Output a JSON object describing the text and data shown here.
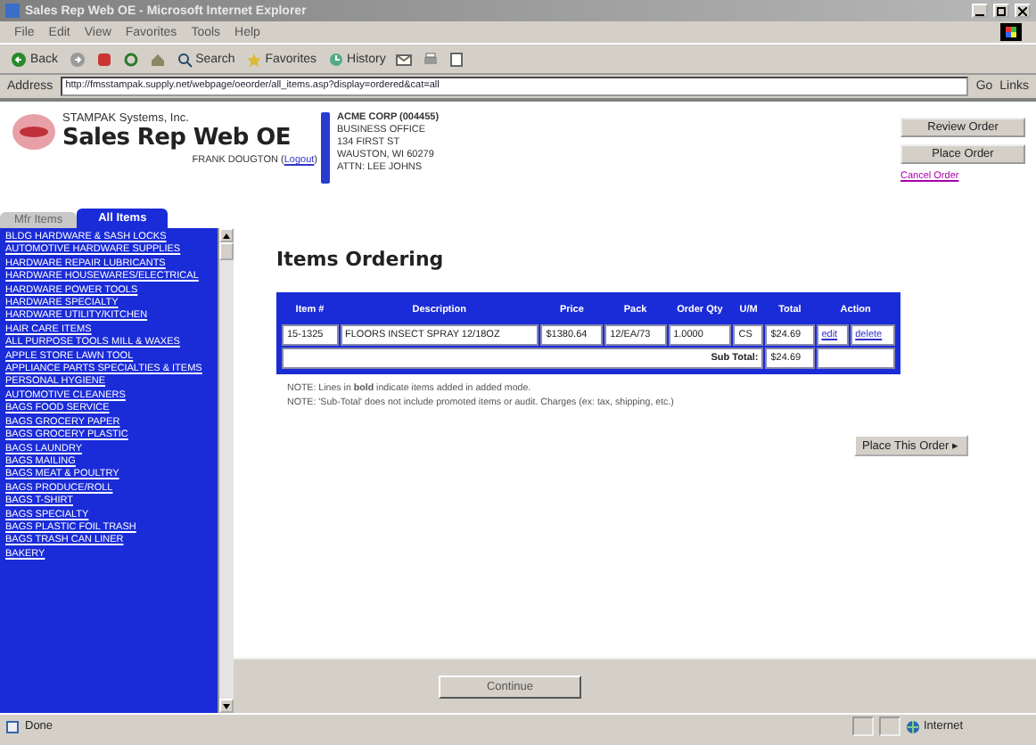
{
  "window": {
    "title": "Sales Rep Web OE - Microsoft Internet Explorer"
  },
  "menu": [
    "File",
    "Edit",
    "View",
    "Favorites",
    "Tools",
    "Help"
  ],
  "toolbar": {
    "back": "Back",
    "buttons": [
      "Search",
      "Favorites",
      "History"
    ]
  },
  "address": {
    "label": "Address",
    "value": "http://fmsstampak.supply.net/webpage/oeorder/all_items.asp?display=ordered&cat=all",
    "go": "Go",
    "links": "Links"
  },
  "header": {
    "company": "STAMPAK Systems, Inc.",
    "app_name": "Sales Rep Web OE",
    "user": "FRANK DOUGTON",
    "logout_open": "(",
    "logout": "Logout",
    "logout_close": ")",
    "customer_lines": [
      "ACME CORP (004455)",
      "BUSINESS OFFICE",
      "134 FIRST ST",
      "WAUSTON, WI 60279",
      "ATTN: LEE JOHNS"
    ],
    "actions": [
      "Review Order",
      "Place Order"
    ],
    "cancel_link": "Cancel Order"
  },
  "tabs": [
    {
      "label": "Mfr Items",
      "selected": false
    },
    {
      "label": "All Items",
      "selected": true
    }
  ],
  "categories": [
    "BLDG HARDWARE & SASH LOCKS",
    "AUTOMOTIVE HARDWARE SUPPLIES",
    "HARDWARE REPAIR LUBRICANTS",
    "HARDWARE HOUSEWARES/ELECTRICAL",
    "HARDWARE POWER TOOLS",
    "HARDWARE SPECIALTY",
    "HARDWARE UTILITY/KITCHEN",
    "HAIR CARE ITEMS",
    "ALL PURPOSE TOOLS MILL & WAXES",
    "APPLE STORE LAWN TOOL",
    "APPLIANCE PARTS SPECIALTIES & ITEMS",
    "PERSONAL HYGIENE",
    "AUTOMOTIVE CLEANERS",
    "BAGS FOOD SERVICE",
    "BAGS GROCERY PAPER",
    "BAGS GROCERY PLASTIC",
    "BAGS LAUNDRY",
    "BAGS MAILING",
    "BAGS MEAT & POULTRY",
    "BAGS PRODUCE/ROLL",
    "BAGS T-SHIRT",
    "BAGS SPECIALTY",
    "BAGS PLASTIC FOIL TRASH",
    "BAGS TRASH CAN LINER",
    "BAKERY"
  ],
  "main": {
    "heading": "Items Ordering",
    "table": {
      "columns": [
        "Item #",
        "Description",
        "Price",
        "Pack",
        "Order Qty",
        "U/M",
        "Total",
        "Action"
      ],
      "rows": [
        {
          "cells": [
            "15-1325",
            "FLOORS INSECT SPRAY 12/18OZ",
            "$1380.64",
            "12/EA/73",
            "1.0000",
            "CS",
            "$24.69"
          ],
          "actions": [
            "edit",
            "delete"
          ]
        }
      ],
      "subtotal_label": "Sub Total:",
      "subtotal": "$24.69"
    },
    "notes": [
      "NOTE: Lines in **bold** indicate items added in added mode.",
      "NOTE: 'Sub-Total' does not include promoted items or audit. Charges (ex: tax, shipping, etc.)"
    ],
    "place_button": "Place This Order ▸"
  },
  "bottom_button": "Continue",
  "status_bar": {
    "text": "Done",
    "zone": "Internet"
  }
}
